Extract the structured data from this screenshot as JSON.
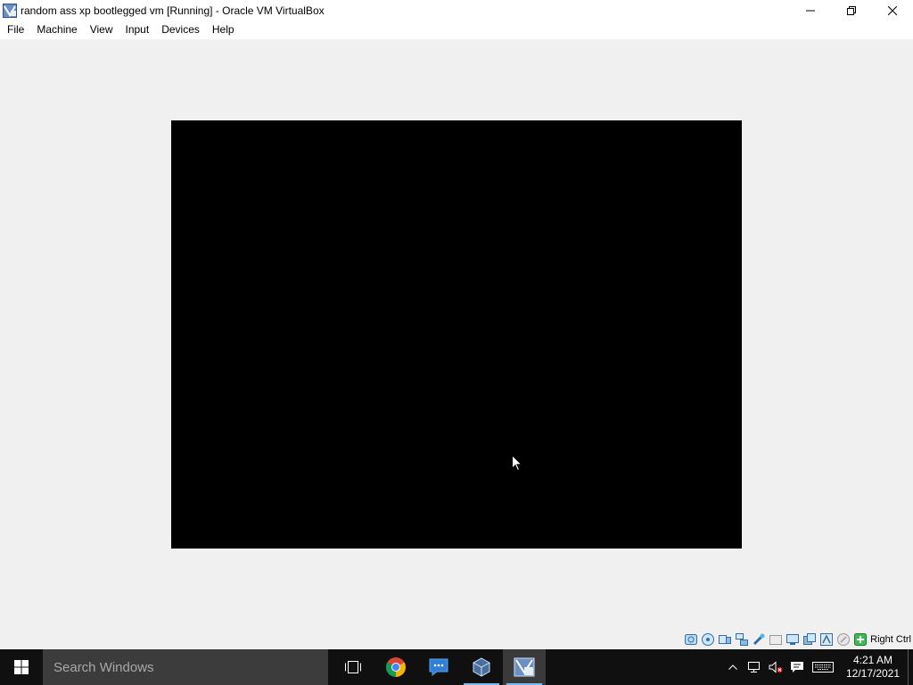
{
  "window": {
    "title": "random ass xp bootlegged vm [Running] - Oracle VM VirtualBox",
    "icon": "virtualbox-icon",
    "controls": [
      "minimize-icon",
      "restore-icon",
      "close-icon"
    ]
  },
  "menu": {
    "items": [
      {
        "label": "File"
      },
      {
        "label": "Machine"
      },
      {
        "label": "View"
      },
      {
        "label": "Input"
      },
      {
        "label": "Devices"
      },
      {
        "label": "Help"
      }
    ]
  },
  "vm": {
    "screen_color": "#000000"
  },
  "statusbar": {
    "icons": [
      "hard-disk-icon",
      "optical-drive-icon",
      "audio-icon",
      "network-icon",
      "usb-icon",
      "shared-folders-icon",
      "display-icon",
      "recording-icon",
      "cpu-icon",
      "mouse-integration-icon",
      "host-key-icon"
    ],
    "host_key": "Right Ctrl"
  },
  "taskbar": {
    "search_placeholder": "Search Windows",
    "apps": [
      {
        "name": "task-view-icon",
        "active": false
      },
      {
        "name": "chrome-icon",
        "active": false
      },
      {
        "name": "chat-icon",
        "active": false
      },
      {
        "name": "virtualbox-manager-icon",
        "active": false
      },
      {
        "name": "virtualbox-vm-icon",
        "active": true
      }
    ],
    "tray_icons": [
      "chevron-up-icon",
      "network-icon",
      "volume-muted-icon",
      "notification-icon",
      "keyboard-icon"
    ],
    "time": "4:21 AM",
    "date": "12/17/2021"
  },
  "colors": {
    "accent": "#76b9ed",
    "taskbar": "#101010",
    "search": "#3c3c3c"
  }
}
